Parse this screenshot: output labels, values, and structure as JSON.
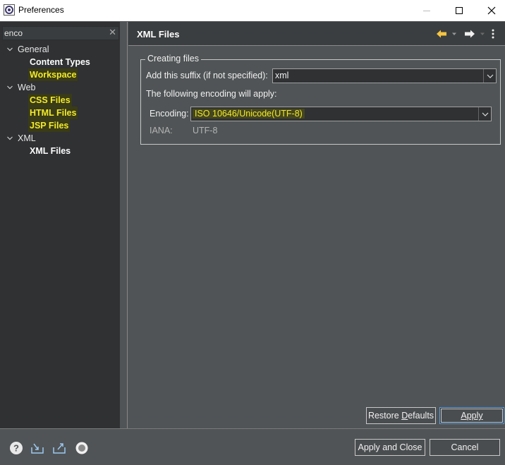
{
  "window": {
    "title": "Preferences"
  },
  "filter": {
    "value": "enco"
  },
  "tree": {
    "general": {
      "label": "General",
      "content_types": "Content Types",
      "workspace": "Workspace"
    },
    "web": {
      "label": "Web",
      "css_files": "CSS Files",
      "html_files": "HTML Files",
      "jsp_files": "JSP Files"
    },
    "xml": {
      "label": "XML",
      "xml_files": "XML Files"
    },
    "highlighted_items": [
      "Workspace",
      "CSS Files",
      "HTML Files",
      "JSP Files"
    ]
  },
  "page": {
    "title": "XML Files",
    "group_title": "Creating files",
    "suffix_label": "Add this suffix (if not specified):",
    "suffix_value": "xml",
    "encoding_info": "The following encoding will apply:",
    "encoding_label": "Encoding:",
    "encoding_value": "ISO 10646/Unicode(UTF-8)",
    "iana_label": "IANA:",
    "iana_value": "UTF-8"
  },
  "buttons": {
    "restore_pre": "Restore ",
    "restore_u": "D",
    "restore_post": "efaults",
    "apply_u": "A",
    "apply_post": "pply",
    "apply_and_close": "Apply and Close",
    "cancel": "Cancel"
  },
  "icons": {
    "app": "eclipse-preferences-icon",
    "back": "back-arrow-icon",
    "forward": "forward-arrow-icon",
    "more": "view-menu-icon",
    "help": "help-icon",
    "import": "import-icon",
    "export": "export-icon",
    "oomph": "oomph-record-icon"
  },
  "colors": {
    "highlight_text": "#f2ea2a",
    "back_arrow": "#f5c542",
    "default_button_border": "#5aa0e6"
  }
}
